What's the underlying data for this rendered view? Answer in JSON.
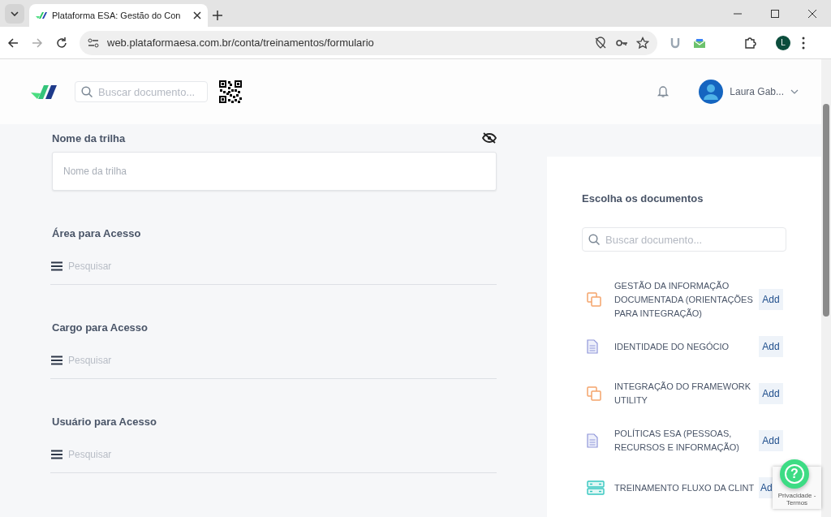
{
  "browser": {
    "tab_title": "Plataforma ESA: Gestão do Con",
    "url": "web.plataformaesa.com.br/conta/treinamentos/formulario",
    "profile_initial": "L"
  },
  "header": {
    "search_placeholder": "Buscar documento...",
    "user_name": "Laura Gab..."
  },
  "form": {
    "name_field": {
      "label": "Nome da trilha",
      "placeholder": "Nome da trilha"
    },
    "access_fields": [
      {
        "label": "Área para Acesso",
        "placeholder": "Pesquisar"
      },
      {
        "label": "Cargo para Acesso",
        "placeholder": "Pesquisar"
      },
      {
        "label": "Usuário para Acesso",
        "placeholder": "Pesquisar"
      }
    ]
  },
  "documents": {
    "title": "Escolha os documentos",
    "search_placeholder": "Buscar documento...",
    "items": [
      {
        "kind": "copy",
        "title": "GESTÃO DA INFORMAÇÃO DOCUMENTADA (ORIENTAÇÕES PARA INTEGRAÇÃO)",
        "action": "Add"
      },
      {
        "kind": "file",
        "title": "IDENTIDADE DO NEGÓCIO",
        "action": "Add"
      },
      {
        "kind": "copy",
        "title": "INTEGRAÇÃO DO FRAMEWORK UTILITY",
        "action": "Add"
      },
      {
        "kind": "file",
        "title": "POLÍTICAS ESA (PESSOAS, RECURSOS E INFORMAÇÃO)",
        "action": "Add"
      },
      {
        "kind": "server",
        "title": "TREINAMENTO FLUXO DA CLINT",
        "action": "Ad",
        "partial": true
      }
    ]
  },
  "help_button": {
    "label": "?"
  },
  "recaptcha": {
    "text": "Privacidade - Termos"
  }
}
